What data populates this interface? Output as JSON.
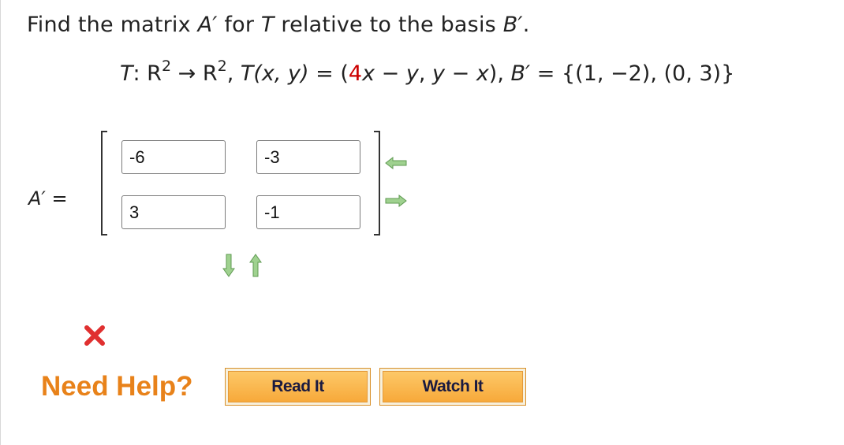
{
  "question": {
    "prefix": "Find the matrix ",
    "matrix_symbol": "A′",
    "middle": " for ",
    "transform_symbol": "T",
    "suffix": " relative to the basis ",
    "basis_symbol": "B′",
    "end": "."
  },
  "equation": {
    "t_label": "T",
    "colon_r": ": R",
    "exp1": "2",
    "arrow_r": " → R",
    "exp2": "2",
    "sep": ", ",
    "t_func": "T",
    "args": "(x, y)",
    "equals_open": " = (",
    "coef_red": "4",
    "rhs_rest_a": "x",
    "rhs_minus1": " − ",
    "rhs_y1": "y",
    "rhs_comma": ", ",
    "rhs_y2": "y",
    "rhs_minus2": " − ",
    "rhs_x2": "x",
    "close": "), ",
    "basis": "B′",
    "basis_value": " = {(1, −2), (0, 3)}"
  },
  "answer": {
    "lhs_label": "A′",
    "lhs_equals": " =",
    "matrix": [
      [
        "-6",
        "-3"
      ],
      [
        "3",
        "-1"
      ]
    ],
    "status": "incorrect"
  },
  "controls": {
    "arrow_left": "move-column-left",
    "arrow_right": "move-column-right",
    "arrow_down": "move-row-down",
    "arrow_up": "move-row-up"
  },
  "help": {
    "label": "Need Help?",
    "read_it": "Read It",
    "watch_it": "Watch It"
  },
  "colors": {
    "accent_orange": "#e8821a",
    "arrow_green": "#8bc77a",
    "wrong_red": "#e03030",
    "coef_red": "#cc0000"
  }
}
